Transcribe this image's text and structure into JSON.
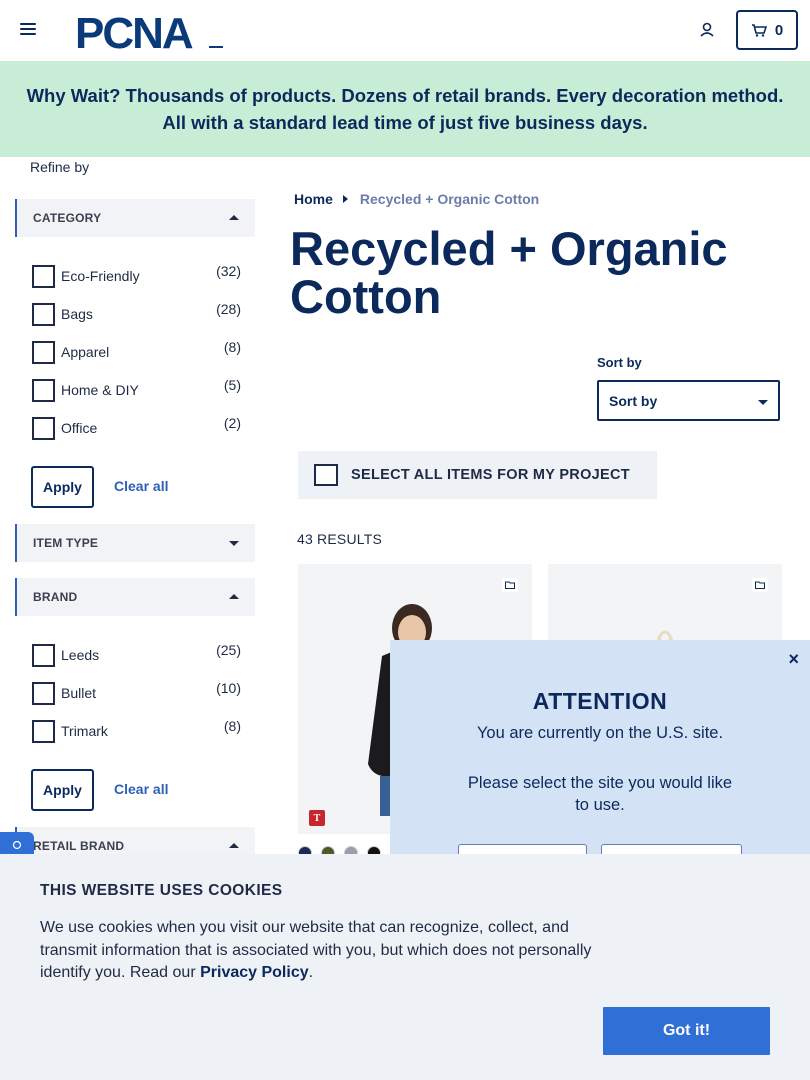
{
  "header": {
    "logo_text": "PCNA",
    "cart_count": "0"
  },
  "banner": {
    "text": "Why Wait? Thousands of products. Dozens of retail brands. Every decoration method. All with a standard lead time of just five business days."
  },
  "sidebar": {
    "refine_label": "Refine by",
    "category": {
      "title": "CATEGORY",
      "options": [
        {
          "label": "Eco-Friendly",
          "count": "(32)"
        },
        {
          "label": "Bags",
          "count": "(28)"
        },
        {
          "label": "Apparel",
          "count": "(8)"
        },
        {
          "label": "Home & DIY",
          "count": "(5)"
        },
        {
          "label": "Office",
          "count": "(2)"
        }
      ],
      "apply_label": "Apply",
      "clear_label": "Clear all"
    },
    "item_type": {
      "title": "ITEM TYPE"
    },
    "brand": {
      "title": "BRAND",
      "options": [
        {
          "label": "Leeds",
          "count": "(25)"
        },
        {
          "label": "Bullet",
          "count": "(10)"
        },
        {
          "label": "Trimark",
          "count": "(8)"
        }
      ],
      "apply_label": "Apply",
      "clear_label": "Clear all"
    },
    "retail_brand": {
      "title": "RETAIL BRAND"
    }
  },
  "main": {
    "breadcrumb": {
      "home": "Home",
      "current": "Recycled + Organic Cotton"
    },
    "title": "Recycled + Organic Cotton",
    "sort": {
      "label": "Sort by",
      "selected": "Sort by"
    },
    "select_all_label": "SELECT ALL ITEMS FOR MY PROJECT",
    "results_label": "43 RESULTS",
    "products": [
      {
        "swatches": [
          "#1b2a55",
          "#4c5a2a",
          "#9aa0a8",
          "#111111"
        ],
        "brand_badge": "T"
      },
      {
        "swatches": []
      }
    ]
  },
  "site_modal": {
    "close": "×",
    "title": "ATTENTION",
    "line1": "You are currently on the U.S. site.",
    "line2": "Please select the site you would like to use."
  },
  "cookie": {
    "title": "THIS WEBSITE USES COOKIES",
    "text_before": "We use cookies when you visit our website that can recognize, collect, and transmit information that is associated with you, but which does not personally identify you. Read our ",
    "link": "Privacy Policy",
    "text_after": ".",
    "button": "Got it!"
  },
  "colors": {
    "navy": "#0b2a5b",
    "banner_bg": "#c8edd6",
    "accent_blue": "#2f6fd6",
    "modal_bg": "#d4e2f5"
  }
}
